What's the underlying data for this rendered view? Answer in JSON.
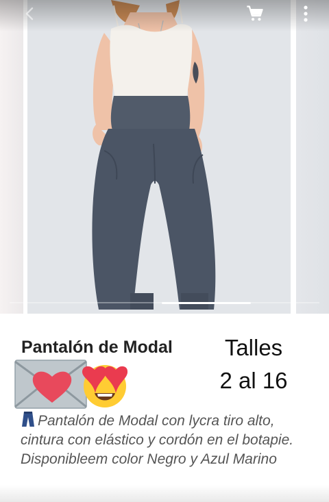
{
  "product": {
    "title": "Pantalón de Modal",
    "sizes_line1": "Talles",
    "sizes_line2": "2 al 16",
    "description": "Pantalón de Modal con lycra tiro alto, cintura con elástico y cordón en el botapie. Disponibleem color Negro y Azul Marino",
    "image": {
      "subject": "model-wearing-navy-modal-pants",
      "top_color": "#f4f1ec",
      "pants_color": "#4b5565",
      "background_color": "#e2e5e9"
    }
  },
  "toolbar": {
    "back_icon": "arrow-back-icon",
    "cart_icon": "shopping-cart-icon",
    "menu_icon": "more-vert-icon"
  },
  "emojis": [
    "envelope-with-heart-icon",
    "heart-eyes-face-icon"
  ],
  "description_icon": "jeans-icon",
  "carousel": {
    "slides_visible": 3,
    "active_slide_fraction": 0.55
  },
  "colors": {
    "title": "#222222",
    "description": "#555555",
    "sizes": "#111111"
  }
}
